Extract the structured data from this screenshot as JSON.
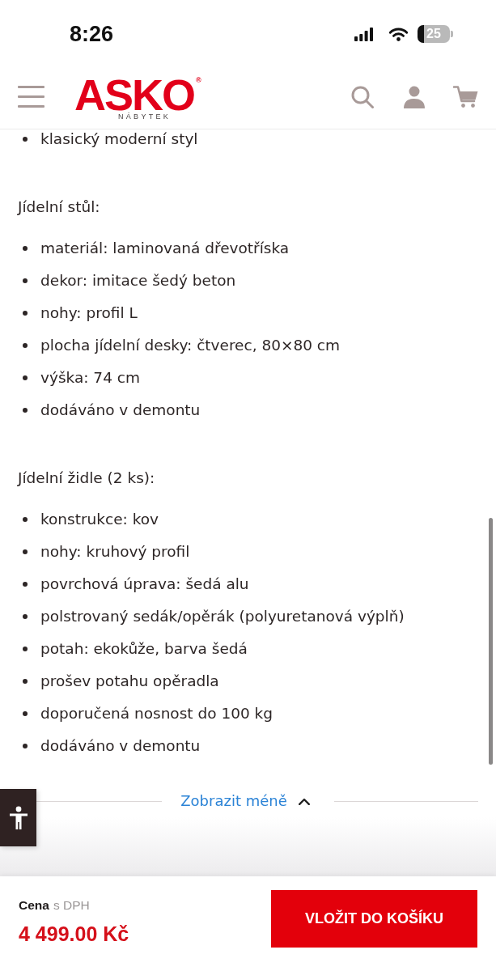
{
  "status_bar": {
    "time": "8:26",
    "battery": "25"
  },
  "header": {
    "logo": "ASKO$^{®}$",
    "logo_tagline": "NÁBYTEK"
  },
  "content": [
    {
      "kind": "list",
      "items": [
        "klasický moderní styl"
      ]
    },
    {
      "kind": "heading",
      "text": "Jídelní stůl:"
    },
    {
      "kind": "list",
      "items": [
        "materiál: laminovaná dřevotříska",
        "dekor: imitace šedý beton",
        "nohy: profil L",
        "plocha jídelní desky: čtverec, 80×80 cm",
        "výška: 74 cm",
        "dodáváno v demontu"
      ]
    },
    {
      "kind": "heading",
      "text": "Jídelní židle (2 ks):"
    },
    {
      "kind": "list",
      "items": [
        "konstrukce: kov",
        "nohy: kruhový profil",
        "povrchová úprava: šedá alu",
        "polstrovaný sedák/opěrák (polyuretanová výplň)",
        "potah: ekokůže, barva šedá",
        "prošev potahu opěradla",
        "doporučená nosnost do 100 kg",
        "dodáváno v demontu"
      ]
    }
  ],
  "toggle": {
    "label": "Zobrazit méně",
    "expanded": true
  },
  "purchase_bar": {
    "price_label": "Cena",
    "price_note": "s DPH",
    "price": "4 499.00 Kč",
    "button": "VLOŽIT DO KOŠÍKU"
  }
}
